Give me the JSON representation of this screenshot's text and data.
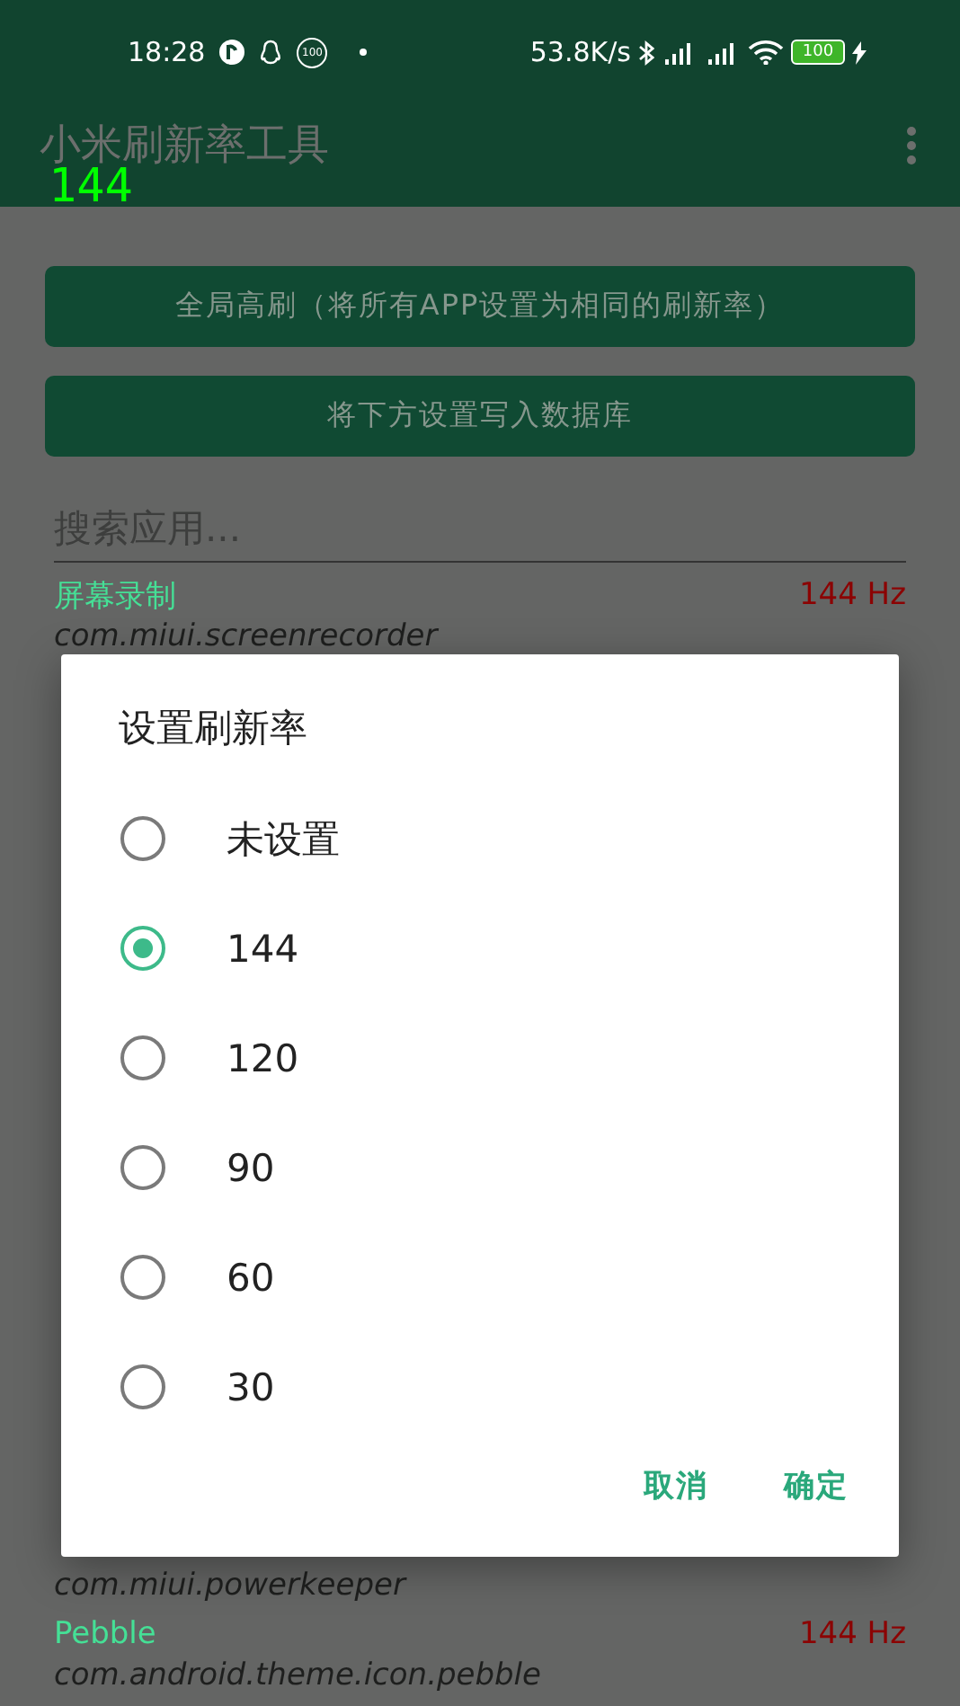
{
  "status_bar": {
    "time": "18:28",
    "notification_badge": "100",
    "net_speed": "53.8K/s",
    "battery": "100"
  },
  "fps_overlay": "144",
  "app_bar": {
    "title": "小米刷新率工具"
  },
  "buttons": [
    "全局高刷（将所有APP设置为相同的刷新率）",
    "将下方设置写入数据库"
  ],
  "search": {
    "placeholder": "搜索应用..."
  },
  "apps": [
    {
      "name": "屏幕录制",
      "package": "com.miui.screenrecorder",
      "rate": "144 Hz"
    },
    {
      "package": "com.miui.powerkeeper"
    },
    {
      "name": "Pebble",
      "package": "com.android.theme.icon.pebble",
      "rate": "144 Hz"
    }
  ],
  "dialog": {
    "title": "设置刷新率",
    "options": [
      {
        "label": "未设置",
        "selected": false
      },
      {
        "label": "144",
        "selected": true
      },
      {
        "label": "120",
        "selected": false
      },
      {
        "label": "90",
        "selected": false
      },
      {
        "label": "60",
        "selected": false
      },
      {
        "label": "30",
        "selected": false
      }
    ],
    "actions": [
      "取消",
      "确定"
    ]
  }
}
